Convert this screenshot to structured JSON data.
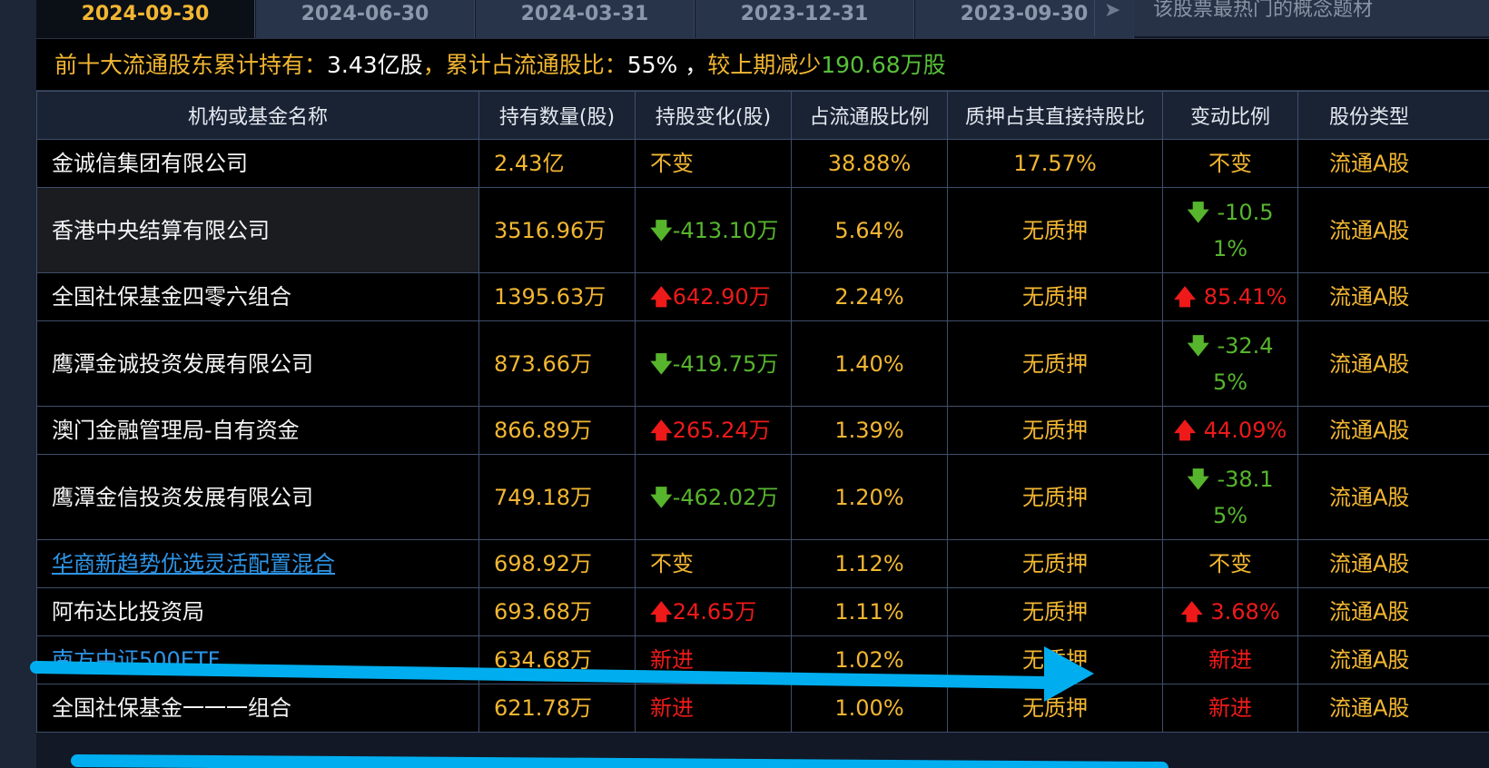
{
  "tabs": [
    "2024-09-30",
    "2024-06-30",
    "2024-03-31",
    "2023-12-31",
    "2023-09-30"
  ],
  "active_tab": "2024-09-30",
  "hint_text": "该股票最热门的概念题材",
  "summary": {
    "prefix": "前十大流通股东累计持有：",
    "total_holding": "3.43亿股",
    "ratio_label": "，累计占流通股比：",
    "ratio_value": "55% ，",
    "change_label": "较上期减少",
    "change_value": "190.68万股"
  },
  "columns": [
    "机构或基金名称",
    "持有数量(股)",
    "持股变化(股)",
    "占流通股比例",
    "质押占其直接持股比",
    "变动比例",
    "股份类型"
  ],
  "rows": [
    {
      "name": "金诚信集团有限公司",
      "link": false,
      "holding": "2.43亿",
      "change": "不变",
      "change_dir": "flat",
      "float_ratio": "38.88%",
      "pledge": "17.57%",
      "change_ratio": "不变",
      "change_ratio_dir": "flat",
      "share_type": "流通A股"
    },
    {
      "name": "香港中央结算有限公司",
      "link": false,
      "highlight": true,
      "holding": "3516.96万",
      "change": "-413.10万",
      "change_dir": "down",
      "float_ratio": "5.64%",
      "pledge": "无质押",
      "change_ratio": "-10.51%",
      "change_ratio_dir": "down",
      "share_type": "流通A股"
    },
    {
      "name": "全国社保基金四零六组合",
      "link": false,
      "holding": "1395.63万",
      "change": "642.90万",
      "change_dir": "up",
      "float_ratio": "2.24%",
      "pledge": "无质押",
      "change_ratio": "85.41%",
      "change_ratio_dir": "up",
      "share_type": "流通A股"
    },
    {
      "name": "鹰潭金诚投资发展有限公司",
      "link": false,
      "holding": "873.66万",
      "change": "-419.75万",
      "change_dir": "down",
      "float_ratio": "1.40%",
      "pledge": "无质押",
      "change_ratio": "-32.45%",
      "change_ratio_dir": "down",
      "share_type": "流通A股"
    },
    {
      "name": "澳门金融管理局-自有资金",
      "link": false,
      "holding": "866.89万",
      "change": "265.24万",
      "change_dir": "up",
      "float_ratio": "1.39%",
      "pledge": "无质押",
      "change_ratio": "44.09%",
      "change_ratio_dir": "up",
      "share_type": "流通A股"
    },
    {
      "name": "鹰潭金信投资发展有限公司",
      "link": false,
      "holding": "749.18万",
      "change": "-462.02万",
      "change_dir": "down",
      "float_ratio": "1.20%",
      "pledge": "无质押",
      "change_ratio": "-38.15%",
      "change_ratio_dir": "down",
      "share_type": "流通A股"
    },
    {
      "name": "华商新趋势优选灵活配置混合",
      "link": true,
      "holding": "698.92万",
      "change": "不变",
      "change_dir": "flat",
      "float_ratio": "1.12%",
      "pledge": "无质押",
      "change_ratio": "不变",
      "change_ratio_dir": "flat",
      "share_type": "流通A股"
    },
    {
      "name": "阿布达比投资局",
      "link": false,
      "holding": "693.68万",
      "change": "24.65万",
      "change_dir": "up",
      "float_ratio": "1.11%",
      "pledge": "无质押",
      "change_ratio": "3.68%",
      "change_ratio_dir": "up",
      "share_type": "流通A股"
    },
    {
      "name": "南方中证500ETF",
      "link": true,
      "holding": "634.68万",
      "change": "新进",
      "change_dir": "new",
      "float_ratio": "1.02%",
      "pledge": "无质押",
      "change_ratio": "新进",
      "change_ratio_dir": "new",
      "share_type": "流通A股"
    },
    {
      "name": "全国社保基金一一一组合",
      "link": false,
      "holding": "621.78万",
      "change": "新进",
      "change_dir": "new",
      "float_ratio": "1.00%",
      "pledge": "无质押",
      "change_ratio": "新进",
      "change_ratio_dir": "new",
      "share_type": "流通A股"
    }
  ],
  "colors": {
    "accent": "#f2b632",
    "up": "#ee1a1a",
    "down": "#57b52d",
    "link": "#2e95e6",
    "annotation": "#00aeef"
  }
}
